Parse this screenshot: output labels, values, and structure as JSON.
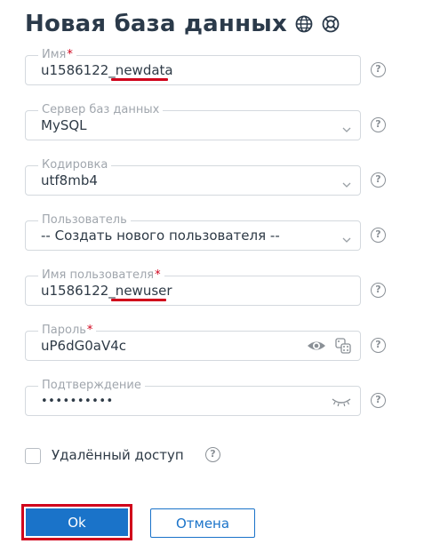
{
  "header": {
    "title": "Новая база данных",
    "icons": [
      "globe-icon",
      "lifebuoy-icon"
    ]
  },
  "form": {
    "name": {
      "label": "Имя",
      "required_mark": "*",
      "value": "u1586122_newdata"
    },
    "server": {
      "label": "Сервер баз данных",
      "value": "MySQL"
    },
    "encoding": {
      "label": "Кодировка",
      "value": "utf8mb4"
    },
    "user": {
      "label": "Пользователь",
      "value": "-- Создать нового пользователя --"
    },
    "username": {
      "label": "Имя пользователя",
      "required_mark": "*",
      "value": "u1586122_newuser"
    },
    "password": {
      "label": "Пароль",
      "required_mark": "*",
      "value": "uP6dG0aV4c"
    },
    "confirm": {
      "label": "Подтверждение",
      "value": "••••••••••"
    },
    "remote_access": {
      "label": "Удалённый доступ",
      "checked": false
    },
    "help_glyph": "?"
  },
  "buttons": {
    "ok_label": "Ok",
    "cancel_label": "Отмена"
  },
  "colors": {
    "accent": "#1a73c9",
    "highlight": "#d0021b",
    "border": "#d4d9de",
    "label": "#a0a6ad"
  }
}
